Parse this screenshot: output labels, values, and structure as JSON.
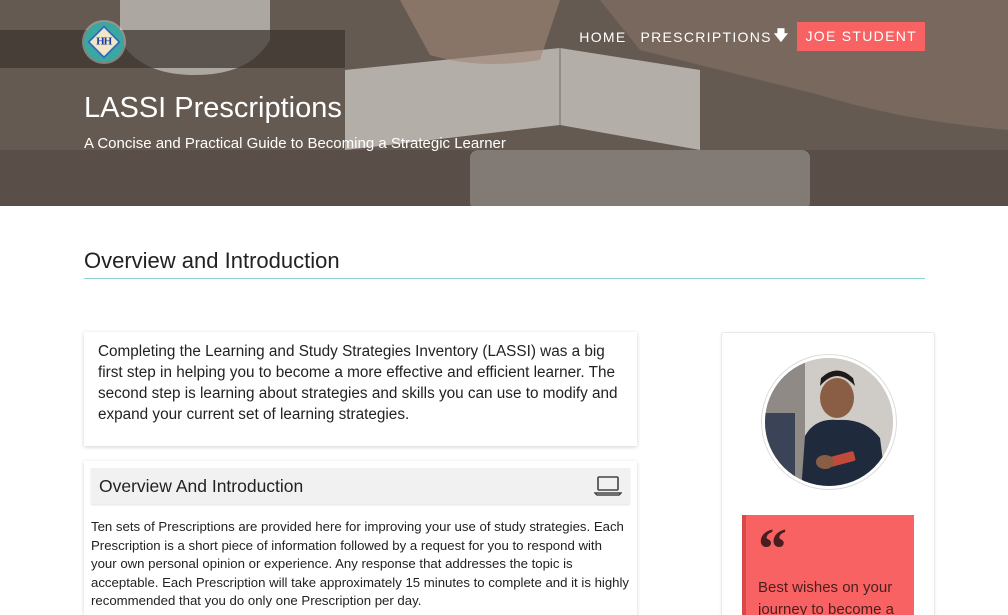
{
  "header": {
    "logo_text": "HH",
    "nav": {
      "home": "HOME",
      "prescriptions": "PRESCRIPTIONS",
      "user": "JOE STUDENT"
    },
    "title": "LASSI Prescriptions",
    "subtitle": "A Concise and Practical Guide to Becoming a Strategic Learner"
  },
  "section": {
    "title": "Overview and Introduction"
  },
  "intro": {
    "text": "Completing the Learning and Study Strategies Inventory (LASSI) was a big first step in helping you to become a more effective and efficient learner. The second step is learning about strategies and skills you can use to modify and expand your current set of learning strategies."
  },
  "overview_card": {
    "title": "Overview And Introduction",
    "icon": "laptop-icon",
    "body": "Ten sets of Prescriptions are provided here for improving your use of study strategies. Each Prescription is a short piece of information followed by a request for you to respond with your own personal opinion or experience. Any response that addresses the topic is acceptable. Each Prescription will take approximately 15 minutes to complete and it is highly recommended that you do only one Prescription per day."
  },
  "sidebar": {
    "quote_icon": "quote-icon",
    "quote_text": "Best wishes on your journey to become a"
  },
  "colors": {
    "accent": "#f96262",
    "divider": "#8fd3d7",
    "logo": "#3aa8a0"
  }
}
